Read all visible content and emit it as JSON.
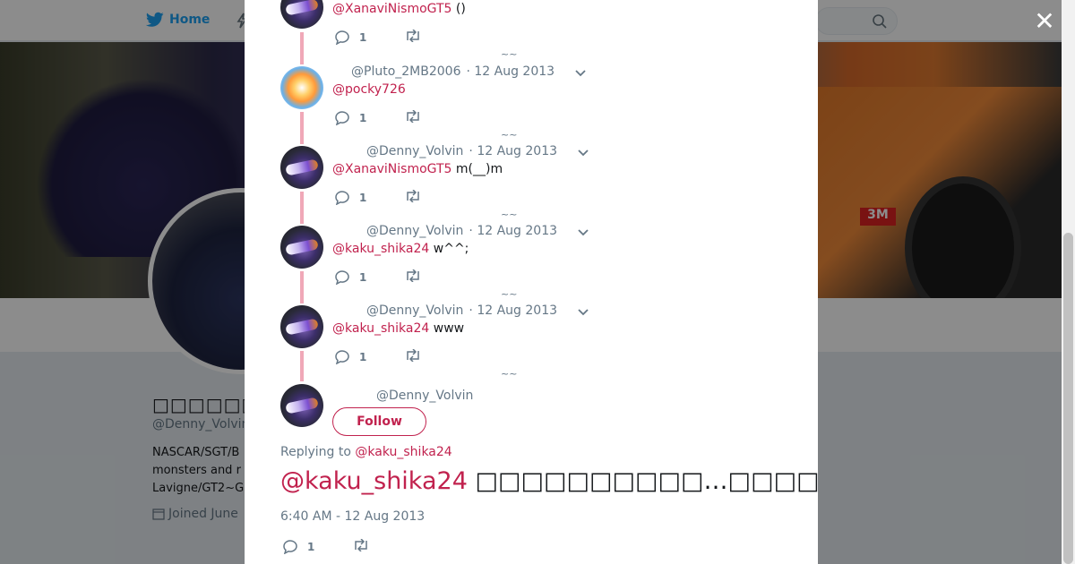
{
  "nav": {
    "home_label": "Home"
  },
  "profile": {
    "name": "□□□□□□",
    "handle": "@Denny_Volvin",
    "bio_lines": [
      "NASCAR/SGT/B",
      "monsters and r",
      "Lavigne/GT2~G"
    ],
    "joined": "Joined June"
  },
  "thread": [
    {
      "handle": "",
      "date": "",
      "mention": "@XanaviNismoGT5",
      "text": " ()",
      "reply_count": "1"
    },
    {
      "handle": "@Pluto_2MB2006",
      "date": "· 12 Aug 2013",
      "mention": "@pocky726",
      "text": "",
      "reply_count": "1"
    },
    {
      "handle": "@Denny_Volvin",
      "date": "· 12 Aug 2013",
      "mention": "@XanaviNismoGT5",
      "text": " m(__)m",
      "reply_count": "1"
    },
    {
      "handle": "@Denny_Volvin",
      "date": "· 12 Aug 2013",
      "mention": "@kaku_shika24",
      "text": " w^^;",
      "reply_count": "1"
    },
    {
      "handle": "@Denny_Volvin",
      "date": "· 12 Aug 2013",
      "mention": "@kaku_shika24",
      "text": " www",
      "reply_count": "1"
    }
  ],
  "main_tweet": {
    "handle": "@Denny_Volvin",
    "follow_label": "Follow",
    "replying_label": "Replying to",
    "replying_to": "@kaku_shika24",
    "mention": "@kaku_shika24",
    "text": " □□□□□□□□□□…□□□□□□□□□□□□□□□□□□□□w",
    "time": "6:40 AM - 12 Aug 2013",
    "reply_count": "1"
  },
  "colors": {
    "accent": "#c1224e",
    "thread_line": "#f0a8b8",
    "twitter_blue": "#1da1f2"
  }
}
